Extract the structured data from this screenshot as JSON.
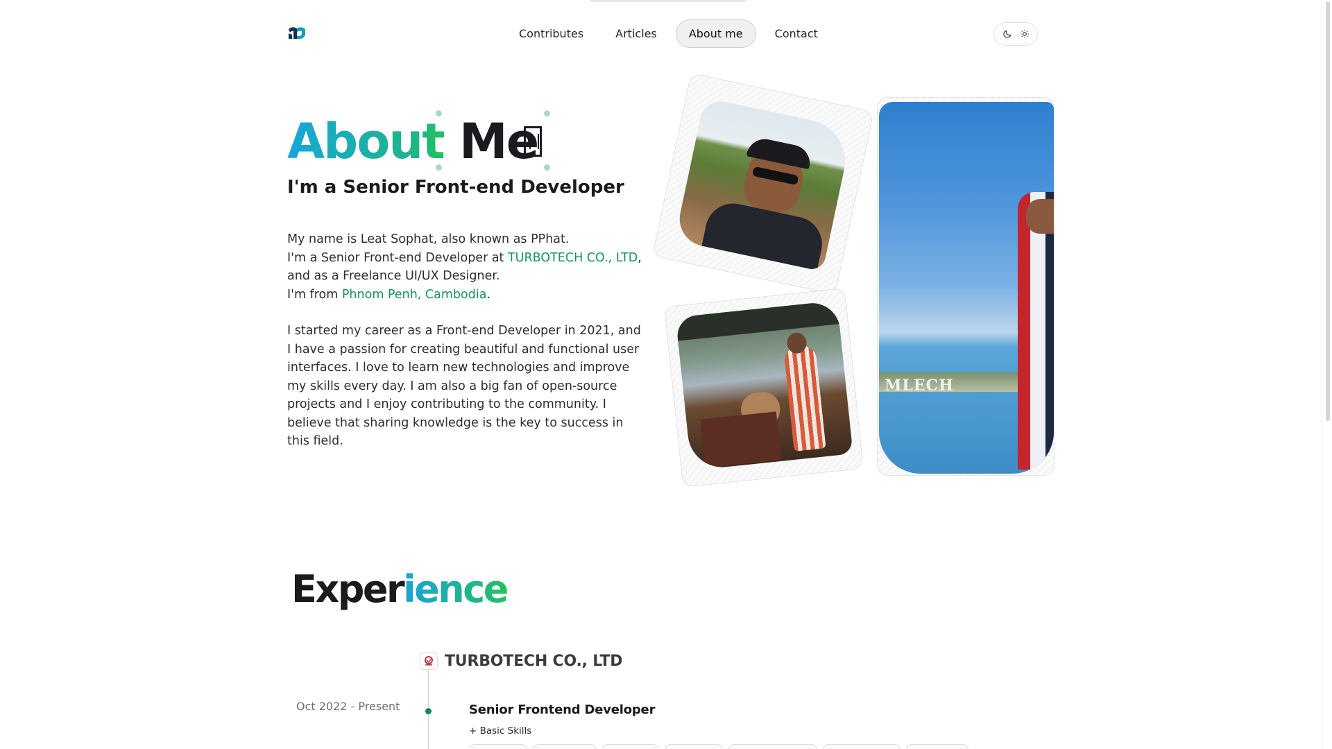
{
  "header": {
    "logo_alt": "PPhat logo",
    "nav": [
      {
        "label": "Contributes",
        "active": false
      },
      {
        "label": "Articles",
        "active": false
      },
      {
        "label": "About me",
        "active": true
      },
      {
        "label": "Contact",
        "active": false
      }
    ],
    "theme_switch": {
      "dark_icon": "moon-icon",
      "light_icon": "sun-icon"
    }
  },
  "hero": {
    "title_part1": "About",
    "title_part2": "Me",
    "subtitle": "I'm a Senior Front-end Developer",
    "bio": {
      "line1": "My name is Leat Sophat, also known as PPhat.",
      "line2_prefix": "I'm a Senior Front-end Developer at ",
      "line2_link": "TURBOTECH CO., LTD",
      "line2_suffix": ",",
      "line3": "and as a Freelance UI/UX Designer.",
      "line4_prefix": "I'm from ",
      "line4_link": "Phnom Penh, Cambodia",
      "line4_suffix": ".",
      "paragraph2": "I started my career as a Front-end Developer in 2021, and I have a passion for creating beautiful and functional user interfaces. I love to learn new technologies and improve my skills every day. I am also a big fan of open-source projects and I enjoy contributing to the community. I believe that sharing knowledge is the key to success in this field."
    },
    "photo_sign_text": "MLECH"
  },
  "experience": {
    "title_part1": "Exper",
    "title_part2": "ience",
    "company": "TURBOTECH CO., LTD",
    "date": "Oct 2022 - Present",
    "role": "Senior Frontend Developer",
    "skills_toggle": "+ Basic Skills"
  },
  "colors": {
    "accent_green": "#17935f",
    "gradient_start": "#17a6d9",
    "gradient_end": "#22c15f",
    "timeline_dot": "#11875a"
  }
}
